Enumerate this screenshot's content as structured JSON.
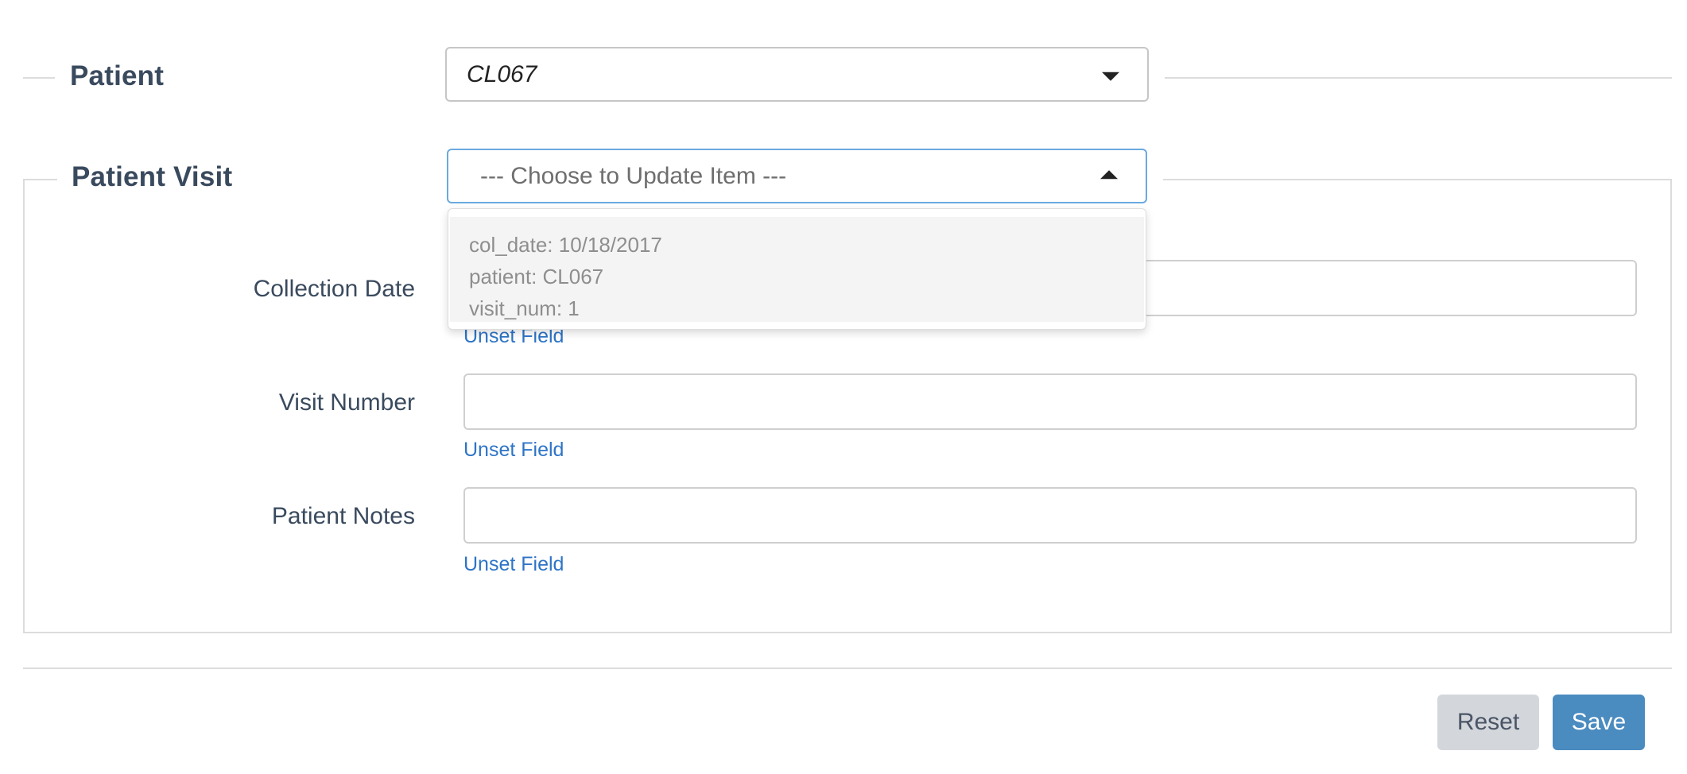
{
  "patient_section": {
    "title": "Patient",
    "select_value": "CL067"
  },
  "visit_section": {
    "title": "Patient Visit",
    "select_placeholder": "--- Choose to Update Item ---",
    "dropdown_option": {
      "lines": [
        "col_date: 10/18/2017",
        "patient: CL067",
        "visit_num: 1"
      ]
    },
    "fields": [
      {
        "label": "Collection Date",
        "value": "",
        "unset_label": "Unset Field"
      },
      {
        "label": "Visit Number",
        "value": "",
        "unset_label": "Unset Field"
      },
      {
        "label": "Patient Notes",
        "value": "",
        "unset_label": "Unset Field"
      }
    ]
  },
  "actions": {
    "reset_label": "Reset",
    "save_label": "Save"
  },
  "colors": {
    "save_button": "#4a8bc0",
    "reset_button": "#d3d6db",
    "link": "#2e74c6",
    "focus_border": "#6aa9e0"
  },
  "icons": {
    "patient_select": "caret-down-icon",
    "visit_select": "caret-up-icon"
  }
}
